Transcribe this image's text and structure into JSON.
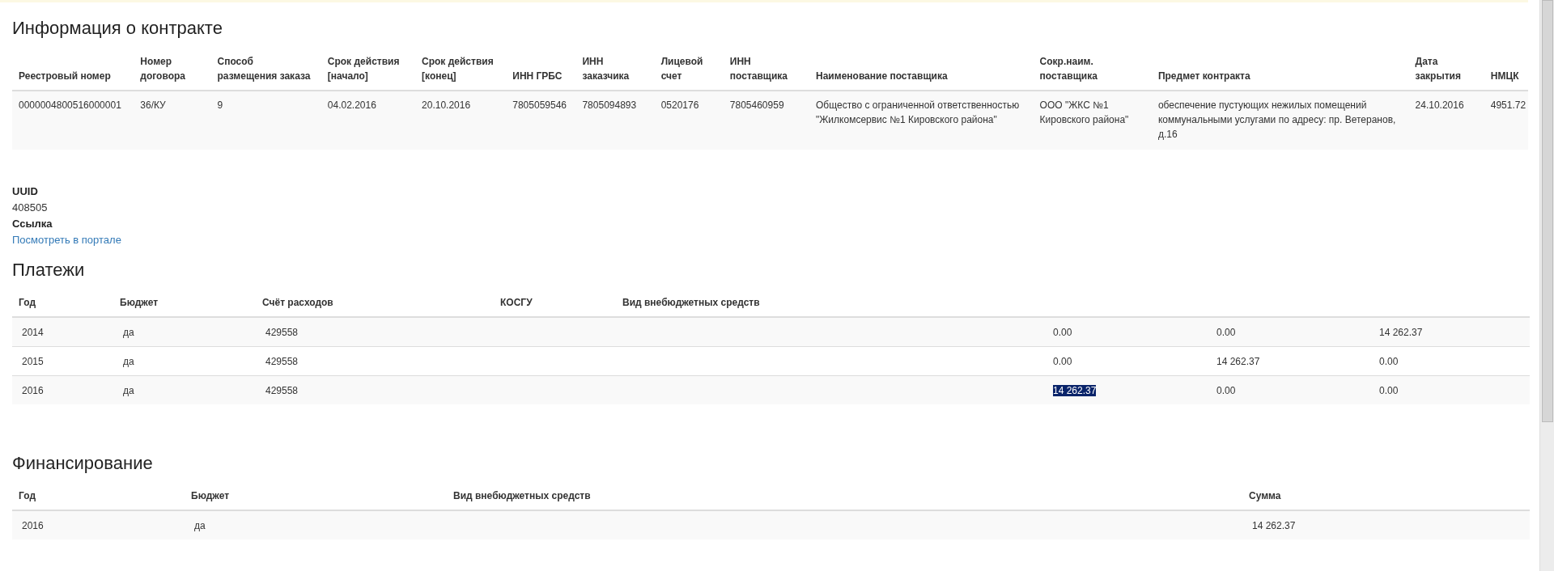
{
  "contract": {
    "title": "Информация о контракте",
    "columns": [
      "Реестровый номер",
      "Номер договора",
      "Способ размещения заказа",
      "Срок действия [начало]",
      "Срок действия [конец]",
      "ИНН ГРБС",
      "ИНН заказчика",
      "Лицевой счет",
      "ИНН поставщика",
      "Наименование поставщика",
      "Сокр.наим. поставщика",
      "Предмет контракта",
      "Дата закрытия",
      "НМЦК"
    ],
    "rows": [
      [
        "0000004800516000001",
        "36/КУ",
        "9",
        "04.02.2016",
        "20.10.2016",
        "7805059546",
        "7805094893",
        "0520176",
        "7805460959",
        "Общество с ограниченной ответственностью \"Жилкомсервис №1 Кировского района\"",
        "ООО \"ЖКС №1 Кировского района\"",
        "обеспечение пустующих нежилых помещений коммунальными услугами по адресу: пр. Ветеранов, д.16",
        "24.10.2016",
        "4951.72"
      ]
    ]
  },
  "details": [
    {
      "label": "UUID",
      "value": "408505",
      "kind": "text"
    },
    {
      "label": "Ссылка",
      "value": "Посмотреть в портале",
      "kind": "link"
    }
  ],
  "payments": {
    "title": "Платежи",
    "columns": [
      "Год",
      "Бюджет",
      "Счёт расходов",
      "КОСГУ",
      "Вид внебюджетных средств",
      null,
      null,
      null
    ],
    "rows": [
      {
        "cells": [
          {
            "text": "2014",
            "selected": false
          },
          {
            "text": "да",
            "selected": false
          },
          {
            "text": "429558",
            "selected": false
          },
          null,
          null,
          {
            "text": "0.00",
            "selected": false
          },
          {
            "text": "0.00",
            "selected": false
          },
          {
            "text": "14 262.37",
            "selected": false
          }
        ]
      },
      {
        "cells": [
          {
            "text": "2015",
            "selected": false
          },
          {
            "text": "да",
            "selected": false
          },
          {
            "text": "429558",
            "selected": false
          },
          null,
          null,
          {
            "text": "0.00",
            "selected": false
          },
          {
            "text": "14 262.37",
            "selected": false
          },
          {
            "text": "0.00",
            "selected": false
          }
        ]
      },
      {
        "cells": [
          {
            "text": "2016",
            "selected": false
          },
          {
            "text": "да",
            "selected": false
          },
          {
            "text": "429558",
            "selected": false
          },
          null,
          null,
          {
            "text": "14 262.37",
            "selected": true
          },
          {
            "text": "0.00",
            "selected": false
          },
          {
            "text": "0.00",
            "selected": false
          }
        ]
      }
    ]
  },
  "financing": {
    "title": "Финансирование",
    "columns": [
      "Год",
      "Бюджет",
      "Вид внебюджетных средств",
      "Сумма"
    ],
    "rows": [
      [
        "2016",
        "да",
        null,
        "14 262.37"
      ]
    ]
  }
}
